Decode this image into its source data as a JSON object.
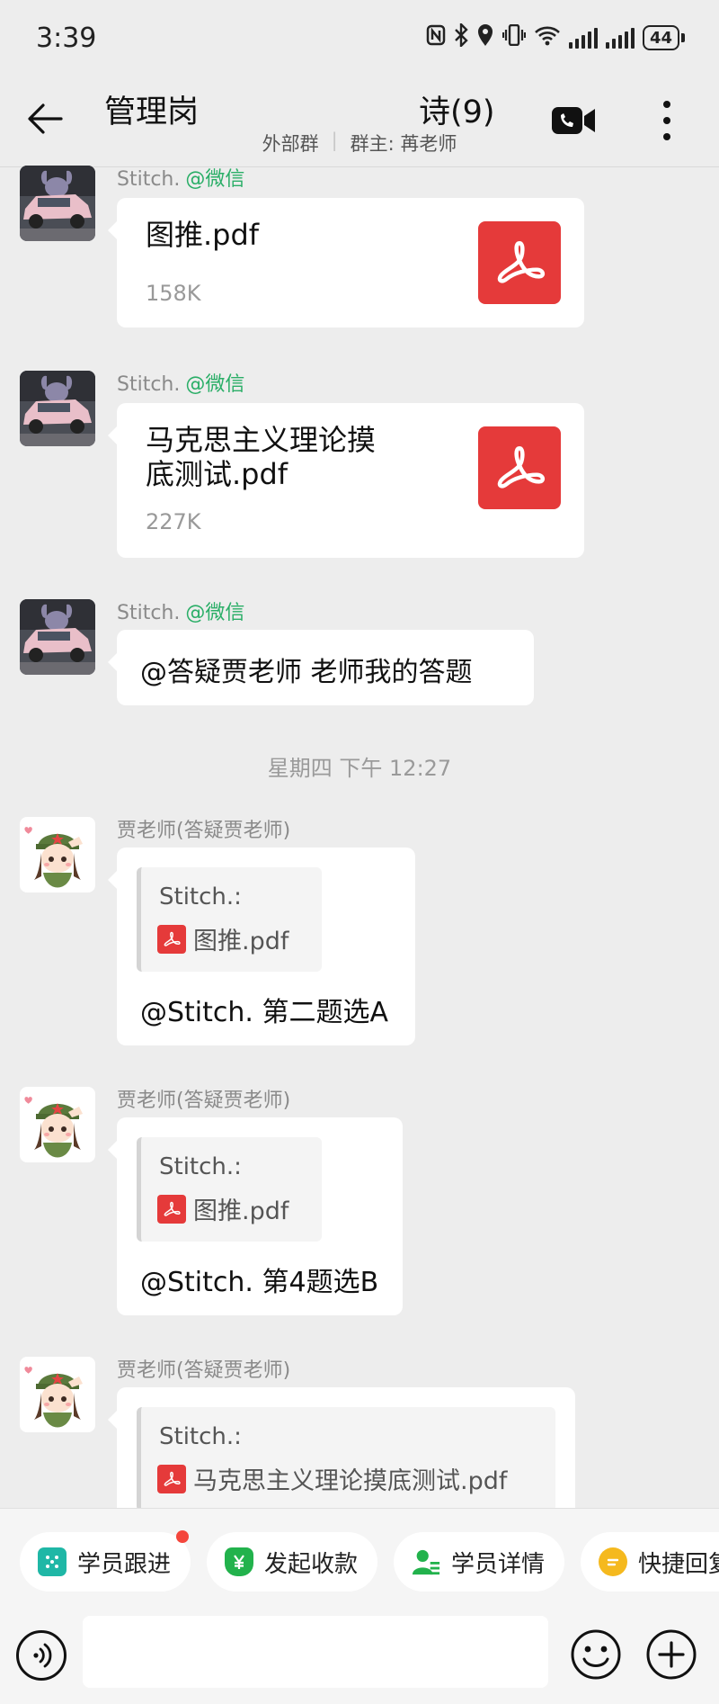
{
  "status_bar": {
    "time": "3:39",
    "battery": "44",
    "icons": [
      "nfc-icon",
      "bluetooth-icon",
      "location-icon",
      "vibrate-icon",
      "wifi-icon",
      "signal-icon",
      "signal-icon",
      "battery-icon"
    ]
  },
  "header": {
    "title": "管理岗       诗(9)",
    "group_type": "外部群",
    "owner": "群主: 苒老师",
    "icons": [
      "back-arrow-icon",
      "video-call-icon",
      "more-icon"
    ]
  },
  "colors": {
    "background": "#ededed",
    "bubble": "#ffffff",
    "pdf_red": "#e53a3a",
    "wechat_green": "#2aae67"
  },
  "messages": [
    {
      "type": "file",
      "sender": "Stitch.",
      "via": "@微信",
      "file_name": "图推.pdf",
      "file_size": "158K"
    },
    {
      "type": "file",
      "sender": "Stitch.",
      "via": "@微信",
      "file_name_line1": "马克思主义理论摸",
      "file_name_line2": "底测试.pdf",
      "file_size": "227K"
    },
    {
      "type": "text",
      "sender": "Stitch.",
      "via": "@微信",
      "text": "@答疑贾老师 老师我的答题"
    },
    {
      "type": "reply",
      "sender": "贾老师(答疑贾老师)",
      "quote_name": "Stitch.:",
      "quote_file": "图推.pdf",
      "text": "@Stitch. 第二题选A"
    },
    {
      "type": "reply",
      "sender": "贾老师(答疑贾老师)",
      "quote_name": "Stitch.:",
      "quote_file": "图推.pdf",
      "text": "@Stitch. 第4题选B"
    },
    {
      "type": "reply",
      "sender": "贾老师(答疑贾老师)",
      "quote_name": "Stitch.:",
      "quote_file": "马克思主义理论摸底测试.pdf",
      "text": ""
    }
  ],
  "time_divider": "星期四  下午 12:27",
  "quick_actions": [
    {
      "label": "学员跟进",
      "icon": "follow-up-icon",
      "badge": true
    },
    {
      "label": "发起收款",
      "icon": "payment-icon",
      "badge": false
    },
    {
      "label": "学员详情",
      "icon": "student-detail-icon",
      "badge": false
    },
    {
      "label": "快捷回复",
      "icon": "quick-reply-icon",
      "badge": false
    }
  ],
  "input_bar": {
    "value": "",
    "icons": [
      "voice-icon",
      "emoji-icon",
      "plus-icon"
    ]
  }
}
